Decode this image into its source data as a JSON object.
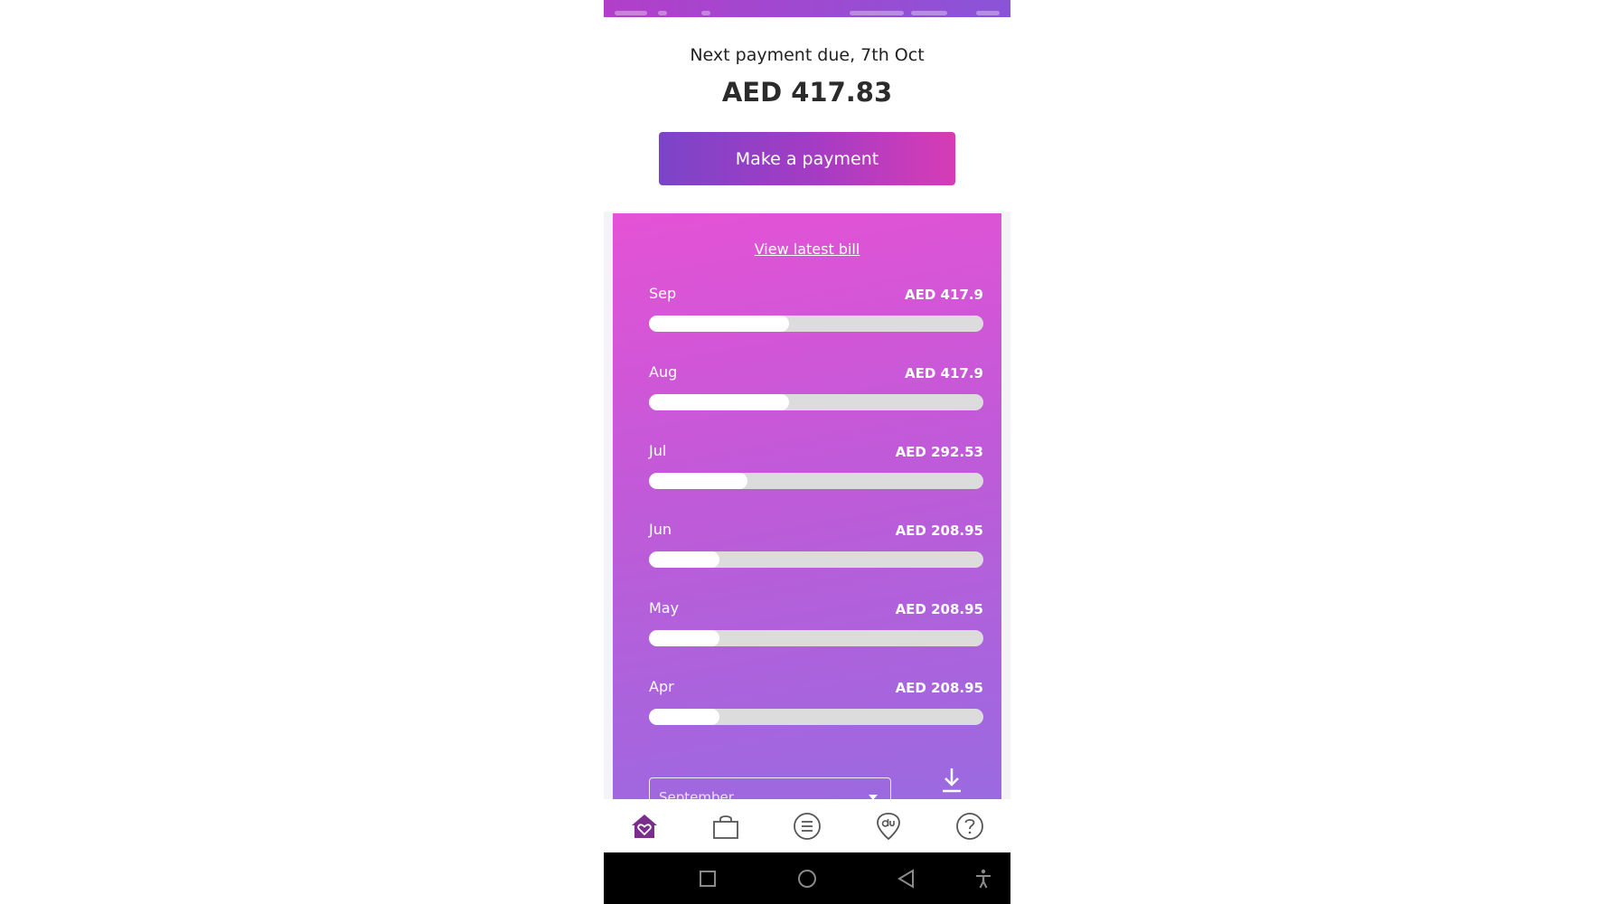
{
  "header": {
    "due_label": "Next payment due, 7th Oct",
    "due_amount": "AED 417.83",
    "pay_button_label": "Make a payment"
  },
  "bill_card": {
    "view_bill_label": "View latest bill",
    "bars": [
      {
        "month": "Sep",
        "amount": "AED 417.9",
        "fill_fraction": 0.42
      },
      {
        "month": "Aug",
        "amount": "AED 417.9",
        "fill_fraction": 0.42
      },
      {
        "month": "Jul",
        "amount": "AED 292.53",
        "fill_fraction": 0.295
      },
      {
        "month": "Jun",
        "amount": "AED 208.95",
        "fill_fraction": 0.21
      },
      {
        "month": "May",
        "amount": "AED 208.95",
        "fill_fraction": 0.21
      },
      {
        "month": "Apr",
        "amount": "AED 208.95",
        "fill_fraction": 0.21
      }
    ],
    "month_select_value": "September"
  },
  "bottom_nav": {
    "items": [
      "home-icon",
      "shopping-bag-icon",
      "menu-list-icon",
      "du-location-icon",
      "help-icon"
    ],
    "active": "home-icon"
  },
  "colors": {
    "accent_purple": "#7b2d8e",
    "button_gradient_start": "#7c44c8",
    "button_gradient_end": "#d63cb6",
    "card_gradient_top": "#e552d6",
    "card_gradient_bottom": "#9a6ae0"
  }
}
